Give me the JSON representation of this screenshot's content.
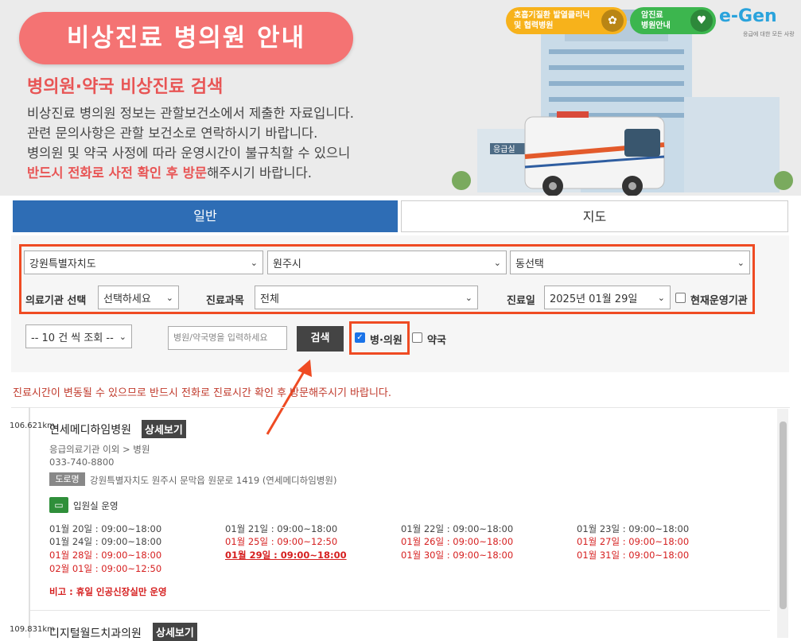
{
  "banner": {
    "title": "비상진료 병의원 안내",
    "subtitle": "병의원·약국 비상진료 검색",
    "lines": [
      "비상진료 병의원 정보는 관할보건소에서 제출한 자료입니다.",
      "관련 문의사항은 관할 보건소로 연락하시기 바랍니다.",
      "병의원 및 약국 사정에 따라 운영시간이 불규칙할 수 있으니"
    ],
    "line4_highlight": "반드시 전화로 사전 확인 후 방문",
    "line4_rest": "해주시기 바랍니다.",
    "badge1_line1": "호흡기질환 발열클리닉",
    "badge1_line2": "및 협력병원",
    "badge2_line1": "암진료",
    "badge2_line2": "병원안내",
    "logo_text": "e-Gen",
    "logo_sub": "응급에 대한 모든 사랑",
    "building_sign": "응급실"
  },
  "tabs": {
    "general": "일반",
    "map": "지도"
  },
  "filters": {
    "region1": "강원특별자치도",
    "region2": "원주시",
    "region3": "동선택",
    "facility_label": "의료기관 선택",
    "facility_value": "선택하세요",
    "dept_label": "진료과목",
    "dept_value": "전체",
    "date_label": "진료일",
    "date_value": "2025년 01월 29일",
    "open_now_label": "현재운영기관",
    "page_size": "-- 10 건 씩 조회 --",
    "search_placeholder": "병원/약국명을 입력하세요",
    "search_button": "검색",
    "clinic_label": "병·의원",
    "pharmacy_label": "약국"
  },
  "notice": "진료시간이 변동될 수 있으므로 반드시 전화로 진료시간 확인 후 방문해주시기 바랍니다.",
  "results": [
    {
      "distance": "106.621km",
      "name": "연세메디하임병원",
      "detail_label": "상세보기",
      "category": "응급의료기관 이외 > 병원",
      "phone": "033-740-8800",
      "road_label": "도로명",
      "address": "강원특별자치도 원주시 문막읍 원문로 1419 (연세메디하임병원)",
      "ward_label": "입원실 운영",
      "hours": [
        "01월 20일 : 09:00~18:00",
        "01월 21일 : 09:00~18:00",
        "01월 22일 : 09:00~18:00",
        "01월 23일 : 09:00~18:00",
        "01월 24일 : 09:00~18:00",
        "01월 25일 : 09:00~12:50",
        "01월 26일 : 09:00~18:00",
        "01월 27일 : 09:00~18:00",
        "01월 28일 : 09:00~18:00",
        "01월 29일 : 09:00~18:00",
        "01월 30일 : 09:00~18:00",
        "01월 31일 : 09:00~18:00",
        "02월 01일 : 09:00~12:50"
      ],
      "note": "비고 : 휴일 인공신장실만 운영"
    },
    {
      "distance": "109.831km",
      "name": "디지털월드치과의원",
      "detail_label": "상세보기"
    }
  ],
  "colors": {
    "accent_blue": "#2e6db5",
    "highlight_red": "#ef4b23",
    "title_pink": "#f47373",
    "holiday_red": "#d62020"
  }
}
